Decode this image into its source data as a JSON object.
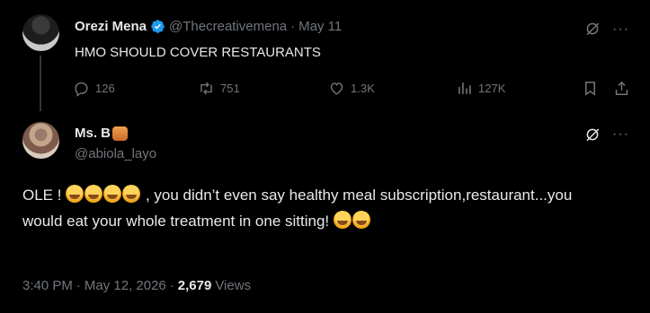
{
  "tweet_parent": {
    "display_name": "Orezi Mena",
    "handle": "@Thecreativemena",
    "separator": "·",
    "date": "May 11",
    "text": "HMO SHOULD COVER RESTAURANTS",
    "replies": "126",
    "retweets": "751",
    "likes": "1.3K",
    "views": "127K",
    "verified_color": "#1d9bf0"
  },
  "tweet_reply": {
    "display_name": "Ms. B",
    "handle": "@abiola_layo",
    "text_before": "OLE !",
    "text_middle": ", you didn’t even say healthy meal subscription,restaurant...you would eat your whole treatment in one sitting!",
    "time": "3:40 PM",
    "separator": "·",
    "date": "May 12, 2026",
    "views_count": "2,679",
    "views_label": "Views"
  },
  "icons": {
    "reply": "reply-icon",
    "retweet": "retweet-icon",
    "like": "heart-icon",
    "views": "views-icon",
    "bookmark": "bookmark-icon",
    "share": "share-icon",
    "grok": "grok-icon",
    "more": "more-icon"
  },
  "colors": {
    "background": "#000000",
    "text_primary": "#e7e9ea",
    "text_secondary": "#71767b"
  }
}
